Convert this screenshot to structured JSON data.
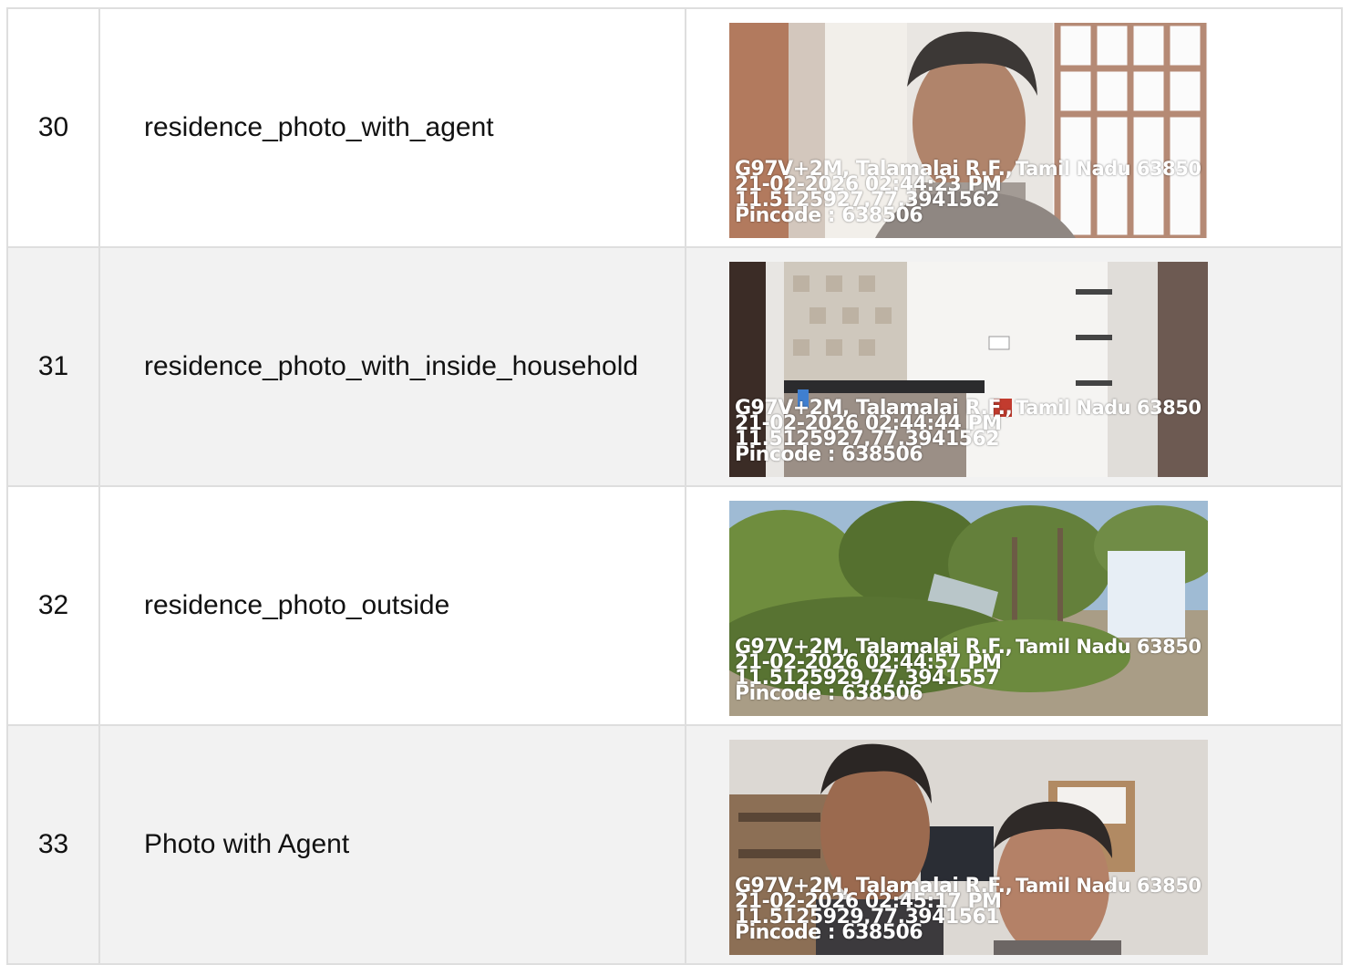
{
  "rows": [
    {
      "number": "30",
      "label": "residence_photo_with_agent",
      "scene": "selfie-indoor",
      "stamp": {
        "location": "G97V+2M, Talamalai R.F.,",
        "state": "Tamil Nadu 63850",
        "datetime": "21-02-2026 02:44:23 PM",
        "coords": "11.5125927,77.3941562",
        "pincode": "Pincode : 638506"
      }
    },
    {
      "number": "31",
      "label": "residence_photo_with_inside_household",
      "scene": "kitchen-interior",
      "stamp": {
        "location": "G97V+2M, Talamalai R.F.,",
        "state": "Tamil Nadu 63850",
        "datetime": "21-02-2026 02:44:44 PM",
        "coords": "11.5125927,77.3941562",
        "pincode": "Pincode : 638506"
      }
    },
    {
      "number": "32",
      "label": "residence_photo_outside",
      "scene": "outdoor-palms",
      "stamp": {
        "location": "G97V+2M, Talamalai R.F.,",
        "state": "Tamil Nadu 63850",
        "datetime": "21-02-2026 02:44:57 PM",
        "coords": "11.5125929,77.3941557",
        "pincode": "Pincode : 638506"
      }
    },
    {
      "number": "33",
      "label": "Photo with Agent",
      "scene": "two-person-selfie",
      "stamp": {
        "location": "G97V+2M, Talamalai R.F.,",
        "state": "Tamil Nadu 63850",
        "datetime": "21-02-2026 02:45:17 PM",
        "coords": "11.5125929,77.3941561",
        "pincode": "Pincode : 638506"
      }
    }
  ]
}
